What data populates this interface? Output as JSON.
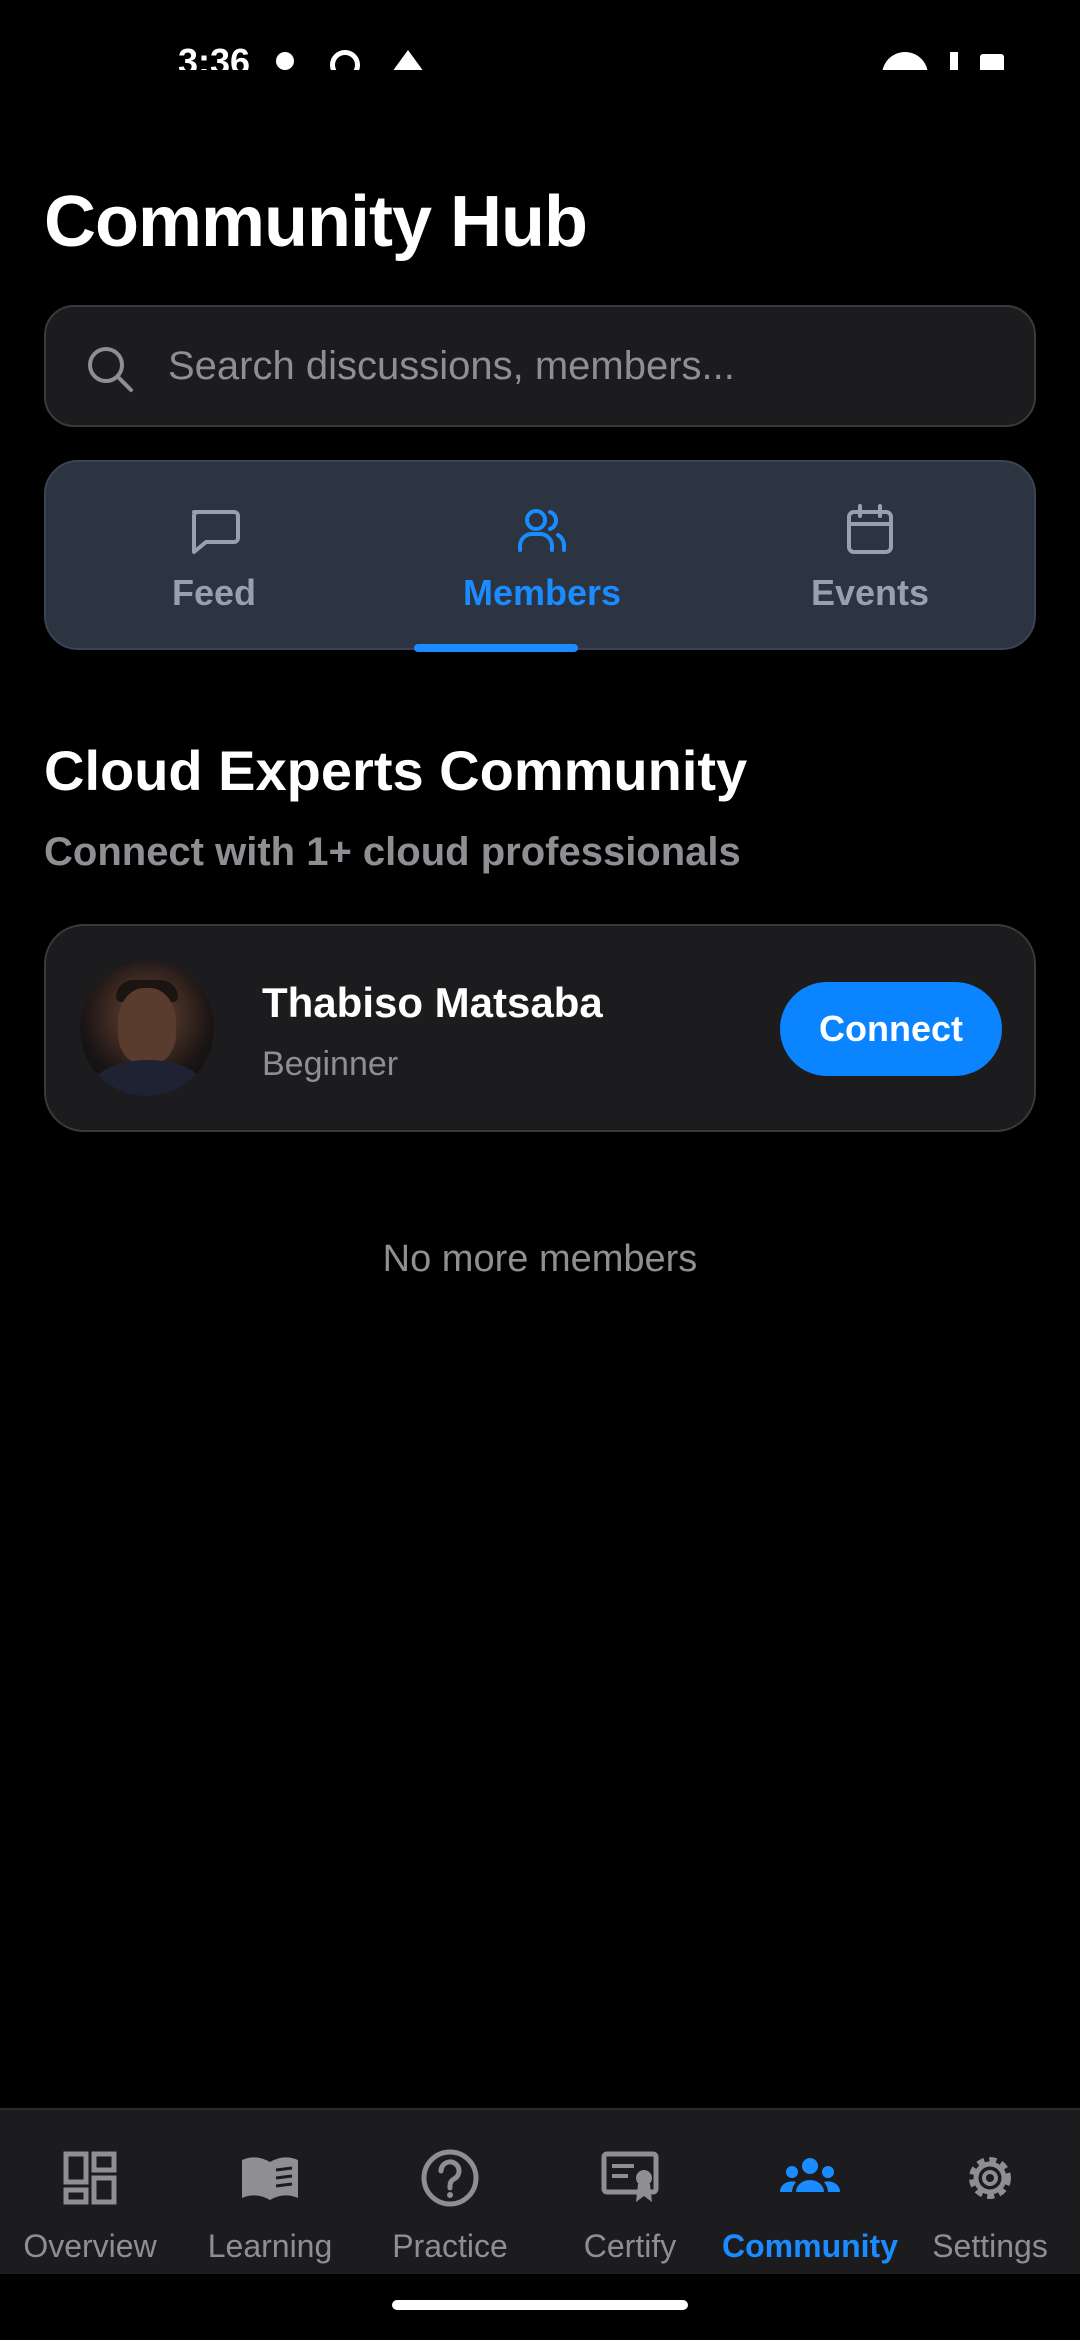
{
  "status_bar": {
    "time": "3:36"
  },
  "header": {
    "title": "Community Hub"
  },
  "search": {
    "placeholder": "Search discussions, members...",
    "value": ""
  },
  "tabs": [
    {
      "label": "Feed",
      "icon": "message-square-icon",
      "active": false
    },
    {
      "label": "Members",
      "icon": "users-icon",
      "active": true
    },
    {
      "label": "Events",
      "icon": "calendar-icon",
      "active": false
    }
  ],
  "section": {
    "title": "Cloud Experts Community",
    "subtitle": "Connect with 1+ cloud professionals"
  },
  "members": [
    {
      "name": "Thabiso Matsaba",
      "level": "Beginner",
      "action": "Connect"
    }
  ],
  "empty_state": "No more members",
  "bottom_nav": [
    {
      "label": "Overview",
      "icon": "dashboard-icon",
      "active": false
    },
    {
      "label": "Learning",
      "icon": "book-open-icon",
      "active": false
    },
    {
      "label": "Practice",
      "icon": "help-circle-icon",
      "active": false
    },
    {
      "label": "Certify",
      "icon": "certificate-icon",
      "active": false
    },
    {
      "label": "Community",
      "icon": "group-icon",
      "active": true
    },
    {
      "label": "Settings",
      "icon": "gear-icon",
      "active": false
    }
  ],
  "colors": {
    "background": "#000000",
    "surface": "#1c1c1e",
    "tab_surface": "#2c3341",
    "accent": "#0a84ff",
    "active_text": "#1a8cff",
    "muted_text": "#8e8e93"
  }
}
